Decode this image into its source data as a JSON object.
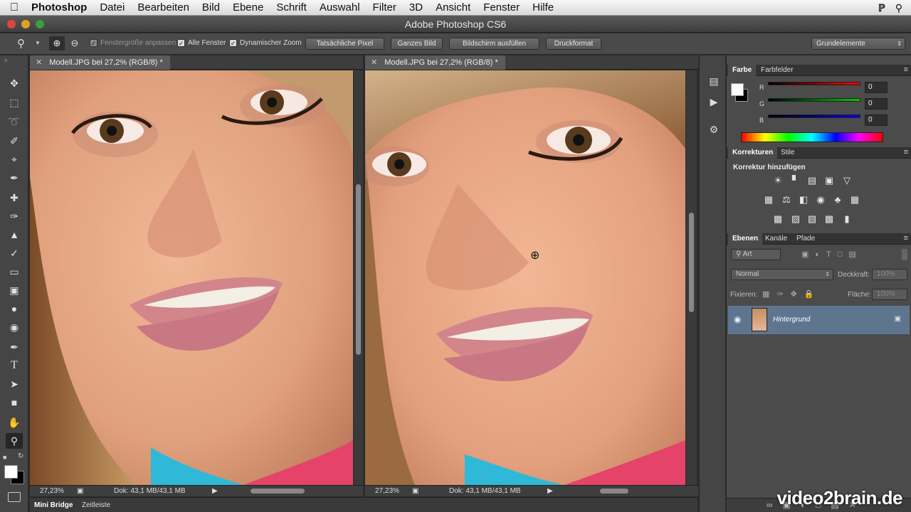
{
  "menubar": {
    "apple_icon": "apple-icon",
    "app": "Photoshop",
    "items": [
      "Datei",
      "Bearbeiten",
      "Bild",
      "Ebene",
      "Schrift",
      "Auswahl",
      "Filter",
      "3D",
      "Ansicht",
      "Fenster",
      "Hilfe"
    ]
  },
  "window": {
    "title": "Adobe Photoshop CS6"
  },
  "options": {
    "fit_window": "Fenstergröße anpassen",
    "all_windows": "Alle Fenster",
    "dynamic_zoom": "Dynamischer Zoom",
    "btn_actual_pixels": "Tatsächliche Pixel",
    "btn_fit_screen": "Ganzes Bild",
    "btn_fill_screen": "Bildschirm ausfüllen",
    "btn_print_size": "Druckformat",
    "workspace": "Grundelemente"
  },
  "documents": [
    {
      "tab": "Modell.JPG bei 27,2% (RGB/8) *",
      "zoom": "27,23%",
      "doc": "Dok: 43,1 MB/43,1 MB"
    },
    {
      "tab": "Modell.JPG bei 27,2% (RGB/8) *",
      "zoom": "27,23%",
      "doc": "Dok: 43,1 MB/43,1 MB"
    }
  ],
  "bottom": {
    "mini_bridge": "Mini Bridge",
    "timeline": "Zeitleiste"
  },
  "color_panel": {
    "tabs": [
      "Farbe",
      "Farbfelder"
    ],
    "labels": [
      "R",
      "G",
      "B"
    ],
    "values": [
      "0",
      "0",
      "0"
    ]
  },
  "adjustments_panel": {
    "tabs": [
      "Korrekturen",
      "Stile"
    ],
    "heading": "Korrektur hinzufügen"
  },
  "layers_panel": {
    "tabs": [
      "Ebenen",
      "Kanäle",
      "Pfade"
    ],
    "filter": "Art",
    "blend_mode": "Normal",
    "opacity_label": "Deckkraft:",
    "opacity": "100%",
    "lock_label": "Fixieren:",
    "fill_label": "Fläche:",
    "fill": "100%",
    "layer_name": "Hintergrund"
  },
  "watermark": "video2brain.de",
  "colors": {
    "accent_layer": "#5e7590",
    "panel_bg": "#4b4b4b"
  }
}
